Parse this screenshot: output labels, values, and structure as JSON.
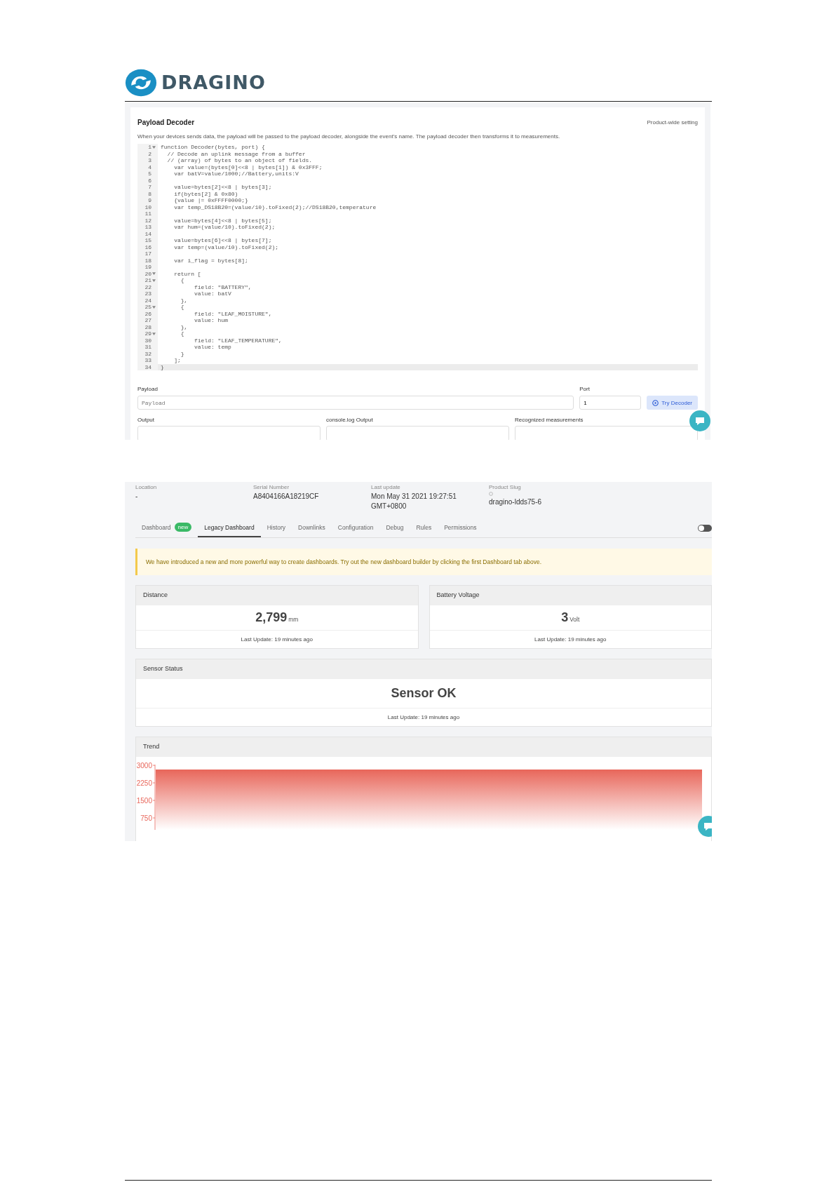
{
  "logo": {
    "text": "DRAGINO"
  },
  "decoder": {
    "title": "Payload Decoder",
    "setting_link": "Product-wide setting",
    "description": "When your devices sends data, the payload will be passed to the payload decoder, alongside the event's name. The payload decoder then transforms it to measurements.",
    "code_lines": [
      {
        "no": "1",
        "fold": true,
        "text": "function Decoder(bytes, port) {"
      },
      {
        "no": "2",
        "fold": false,
        "text": "  // Decode an uplink message from a buffer"
      },
      {
        "no": "3",
        "fold": false,
        "text": "  // (array) of bytes to an object of fields."
      },
      {
        "no": "4",
        "fold": false,
        "text": "    var value=(bytes[0]<<8 | bytes[1]) & 0x3FFF;"
      },
      {
        "no": "5",
        "fold": false,
        "text": "    var batV=value/1000;//Battery,units:V"
      },
      {
        "no": "6",
        "fold": false
      },
      {
        "no": "7",
        "fold": false,
        "text": "    value=bytes[2]<<8 | bytes[3];"
      },
      {
        "no": "8",
        "fold": false,
        "text": "    if(bytes[2] & 0x80)"
      },
      {
        "no": "9",
        "fold": false,
        "text": "    {value |= 0xFFFF0000;}"
      },
      {
        "no": "10",
        "fold": false,
        "text": "    var temp_DS18B20=(value/10).toFixed(2);//DS18B20,temperature"
      },
      {
        "no": "11",
        "fold": false
      },
      {
        "no": "12",
        "fold": false,
        "text": "    value=bytes[4]<<8 | bytes[5];"
      },
      {
        "no": "13",
        "fold": false,
        "text": "    var hum=(value/10).toFixed(2);"
      },
      {
        "no": "14",
        "fold": false
      },
      {
        "no": "15",
        "fold": false,
        "text": "    value=bytes[6]<<8 | bytes[7];"
      },
      {
        "no": "16",
        "fold": false,
        "text": "    var temp=(value/10).toFixed(2);"
      },
      {
        "no": "17",
        "fold": false
      },
      {
        "no": "18",
        "fold": false,
        "text": "    var i_flag = bytes[8];"
      },
      {
        "no": "19",
        "fold": false
      },
      {
        "no": "20",
        "fold": true,
        "text": "    return ["
      },
      {
        "no": "21",
        "fold": true,
        "text": "      {"
      },
      {
        "no": "22",
        "fold": false,
        "text": "          field: \"BATTERY\","
      },
      {
        "no": "23",
        "fold": false,
        "text": "          value: batV"
      },
      {
        "no": "24",
        "fold": false,
        "text": "      },"
      },
      {
        "no": "25",
        "fold": true,
        "text": "      {"
      },
      {
        "no": "26",
        "fold": false,
        "text": "          field: \"LEAF_MOISTURE\","
      },
      {
        "no": "27",
        "fold": false,
        "text": "          value: hum"
      },
      {
        "no": "28",
        "fold": false,
        "text": "      },"
      },
      {
        "no": "29",
        "fold": true,
        "text": "      {"
      },
      {
        "no": "30",
        "fold": false,
        "text": "          field: \"LEAF_TEMPERATURE\","
      },
      {
        "no": "31",
        "fold": false,
        "text": "          value: temp"
      },
      {
        "no": "32",
        "fold": false,
        "text": "      }"
      },
      {
        "no": "33",
        "fold": false,
        "text": "    ];"
      },
      {
        "no": "34",
        "fold": false,
        "text": "}"
      }
    ],
    "payload": {
      "label": "Payload",
      "placeholder": "Payload"
    },
    "port": {
      "label": "Port",
      "value": "1"
    },
    "try_button": "Try Decoder",
    "outputs": [
      "Output",
      "console.log Output",
      "Recognized measurements"
    ]
  },
  "device": {
    "info": [
      {
        "label": "Location",
        "value": "-"
      },
      {
        "label": "Serial Number",
        "value": "A8404166A18219CF"
      },
      {
        "label": "Last update",
        "value": "Mon May 31 2021 19:27:51 GMT+0800"
      },
      {
        "label": "Product Slug",
        "value": "dragino-ldds75-6"
      }
    ],
    "tabs": [
      {
        "label": "Dashboard",
        "badge": "new",
        "selected": false
      },
      {
        "label": "Legacy Dashboard",
        "selected": true
      },
      {
        "label": "History",
        "selected": false
      },
      {
        "label": "Downlinks",
        "selected": false
      },
      {
        "label": "Configuration",
        "selected": false
      },
      {
        "label": "Debug",
        "selected": false
      },
      {
        "label": "Rules",
        "selected": false
      },
      {
        "label": "Permissions",
        "selected": false
      }
    ],
    "toggle": {
      "on": false
    },
    "banner": "We have introduced a new and more powerful way to create dashboards. Try out the new dashboard builder by clicking the first Dashboard tab above.",
    "cards": [
      {
        "title": "Distance",
        "value": "2,799",
        "unit": "mm",
        "updated": "Last Update: 19 minutes ago"
      },
      {
        "title": "Battery Voltage",
        "value": "3",
        "unit": "Volt",
        "updated": "Last Update: 19 minutes ago"
      }
    ],
    "status": {
      "title": "Sensor Status",
      "value": "Sensor OK",
      "updated": "Last Update: 19 minutes ago"
    },
    "trend": {
      "title": "Trend",
      "axis_labels": [
        "3000",
        "2250",
        "1500",
        "750"
      ]
    }
  }
}
